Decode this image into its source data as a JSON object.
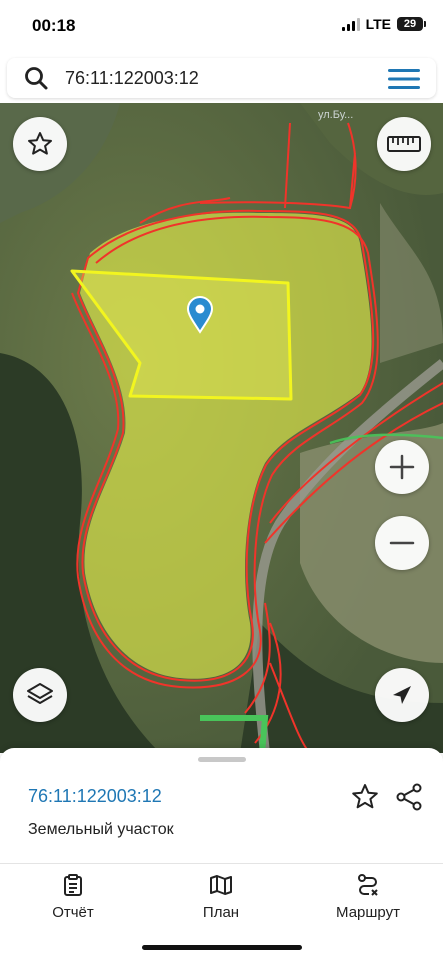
{
  "status_bar": {
    "time": "00:18",
    "network": "LTE",
    "battery": "29"
  },
  "search": {
    "query": "76:11:122003:12"
  },
  "map": {
    "street_label": "ул.Бу..."
  },
  "parcel": {
    "id": "76:11:122003:12",
    "type": "Земельный участок"
  },
  "tabs": [
    {
      "label": "Отчёт",
      "icon": "report-icon"
    },
    {
      "label": "План",
      "icon": "map-plan-icon"
    },
    {
      "label": "Маршрут",
      "icon": "route-icon"
    }
  ],
  "colors": {
    "accent": "#1f77b4",
    "parcel_fill": "#e6f04a",
    "boundary": "#f0342a"
  }
}
